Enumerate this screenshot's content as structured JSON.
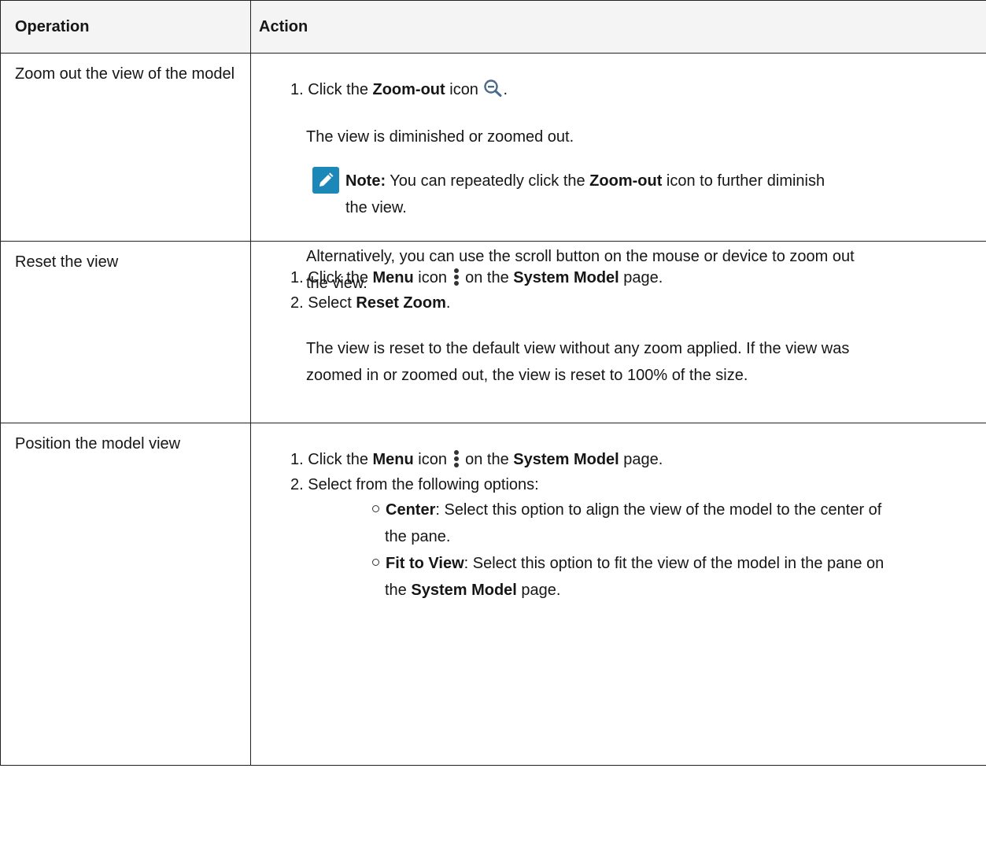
{
  "header": {
    "operation": "Operation",
    "action": "Action"
  },
  "rows": [
    {
      "operation": "Zoom out the view of the model",
      "steps": [
        {
          "num": "1.",
          "pre": "Click the ",
          "bold": "Zoom-out",
          "post": " icon ",
          "icon": "zoom-out-icon",
          "tail": "."
        }
      ],
      "result": "The view is diminished or zoomed out.",
      "note": {
        "label": "Note:",
        "pre": " You can repeatedly click the ",
        "bold": "Zoom-out",
        "post1": " icon to further diminish",
        "line2": "the view."
      },
      "alt_line1": "Alternatively, you can use the scroll button on the mouse or device to zoom out",
      "alt_line2": "the view."
    },
    {
      "operation": "Reset the view",
      "steps": [
        {
          "num": "1.",
          "pre": "Click the ",
          "bold": "Menu",
          "mid": " icon ",
          "icon": "menu-icon",
          "mid2": " on the ",
          "bold2": "System Model",
          "post": " page."
        },
        {
          "num": "2.",
          "pre": "Select ",
          "bold": "Reset Zoom",
          "post": "."
        }
      ],
      "result_line1": "The view is reset to the default view without any zoom applied. If the view was",
      "result_line2": "zoomed in or zoomed out, the view is reset to 100% of the size."
    },
    {
      "operation": "Position the model view",
      "steps": [
        {
          "num": "1.",
          "pre": "Click the ",
          "bold": "Menu",
          "mid": " icon ",
          "icon": "menu-icon",
          "mid2": " on the ",
          "bold2": "System Model",
          "post": " page."
        },
        {
          "num": "2.",
          "text": "Select from the following options:"
        }
      ],
      "options": [
        {
          "bold": "Center",
          "line1": ": Select this option to align the view of the model to the center of",
          "line2": "the pane."
        },
        {
          "bold": "Fit to View",
          "line1": ": Select this option to fit the view of the model in the pane on",
          "line2_pre": "the ",
          "line2_bold": "System Model",
          "line2_post": " page."
        }
      ]
    }
  ]
}
